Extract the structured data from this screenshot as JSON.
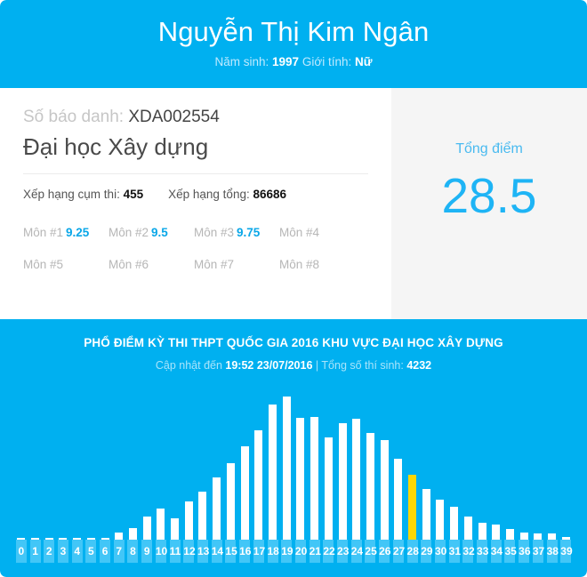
{
  "header": {
    "name": "Nguyễn Thị Kim Ngân",
    "birth_label": "Năm sinh:",
    "birth_year": "1997",
    "gender_label": "Giới tính:",
    "gender": "Nữ"
  },
  "info": {
    "sbd_label": "Số báo danh:",
    "sbd_value": "XDA002554",
    "school": "Đại học Xây dựng",
    "rank_cluster_label": "Xếp hạng cụm thi:",
    "rank_cluster_value": "455",
    "rank_total_label": "Xếp hạng tổng:",
    "rank_total_value": "86686",
    "subjects": [
      {
        "label": "Môn #1",
        "score": "9.25"
      },
      {
        "label": "Môn #2",
        "score": "9.5"
      },
      {
        "label": "Môn #3",
        "score": "9.75"
      },
      {
        "label": "Môn #4",
        "score": ""
      },
      {
        "label": "Môn #5",
        "score": ""
      },
      {
        "label": "Môn #6",
        "score": ""
      },
      {
        "label": "Môn #7",
        "score": ""
      },
      {
        "label": "Môn #8",
        "score": ""
      }
    ]
  },
  "total": {
    "label": "Tổng điểm",
    "value": "28.5"
  },
  "chart_header": {
    "title": "PHỔ ĐIỂM KỲ THI THPT QUỐC GIA 2016 KHU VỰC ĐẠI HỌC XÂY DỰNG",
    "updated_label": "Cập nhật đến",
    "updated_time": "19:52 23/07/2016",
    "separator": "|",
    "candidates_label": "Tổng số thí sinh:",
    "candidates_value": "4232"
  },
  "colors": {
    "brand_blue": "#00b0f0",
    "tick_blue": "#42c6f7",
    "bar_white": "#ffffff",
    "highlight_yellow": "#fcd703",
    "panel_gray": "#f5f5f5",
    "score_blue": "#1eb4f5"
  },
  "chart_data": {
    "type": "bar",
    "title": "PHỔ ĐIỂM KỲ THI THPT QUỐC GIA 2016 KHU VỰC ĐẠI HỌC XÂY DỰNG",
    "xlabel": "",
    "ylabel": "",
    "grid": false,
    "legend": "none",
    "highlight_category": "28",
    "highlight_color": "#fcd703",
    "bar_color": "#ffffff",
    "ylim": [
      0,
      180
    ],
    "categories": [
      "0",
      "1",
      "2",
      "3",
      "4",
      "5",
      "6",
      "7",
      "8",
      "9",
      "10",
      "11",
      "12",
      "13",
      "14",
      "15",
      "16",
      "17",
      "18",
      "19",
      "20",
      "21",
      "22",
      "23",
      "24",
      "25",
      "26",
      "27",
      "28",
      "29",
      "30",
      "31",
      "32",
      "33",
      "34",
      "35",
      "36",
      "37",
      "38",
      "39"
    ],
    "values": [
      2,
      2,
      2,
      1,
      2,
      2,
      2,
      8,
      13,
      26,
      35,
      24,
      43,
      55,
      71,
      87,
      106,
      124,
      154,
      163,
      139,
      140,
      116,
      132,
      138,
      121,
      113,
      92,
      74,
      58,
      46,
      37,
      26,
      19,
      17,
      12,
      8,
      7,
      7,
      3
    ]
  }
}
